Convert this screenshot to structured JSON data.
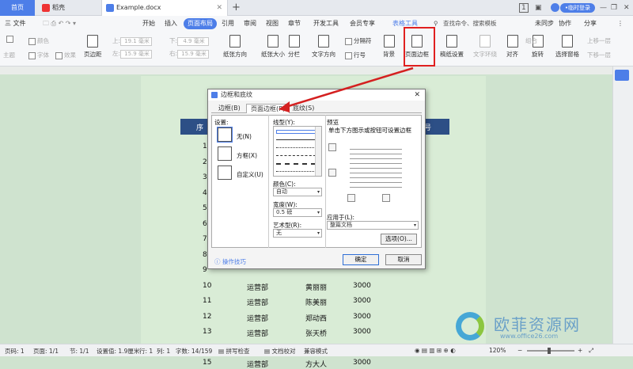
{
  "tabs": {
    "home": "首页",
    "doc": "稻壳",
    "file": "Example.docx"
  },
  "window": {
    "login_label": "•临时登录",
    "badge": "1"
  },
  "menu": {
    "file": "三 文件",
    "items": [
      "开始",
      "插入",
      "页面布局",
      "引用",
      "审阅",
      "视图",
      "章节",
      "开发工具",
      "会员专享",
      "表格工具"
    ],
    "active": "页面布局",
    "search": "查找命令、搜索模板",
    "right": [
      "未同步",
      "协作",
      "分享"
    ]
  },
  "ribbon": {
    "theme": "主题",
    "color": "颜色",
    "font": "字体",
    "effect": "效果",
    "margin": "页边距",
    "top_label": "上:",
    "top_value": "19.1 毫米",
    "bottom_label": "下:",
    "bottom_value": "4.9 毫米",
    "left_label": "左:",
    "left_value": "15.9 毫米",
    "right_label": "右:",
    "right_value": "15.9 毫米",
    "orientation": "纸张方向",
    "size": "纸张大小",
    "columns": "分栏",
    "text_dir": "文字方向",
    "breaks": "分隔符",
    "line_num": "行号",
    "background": "背景",
    "page_border": "页面边框",
    "draft": "稿纸设置",
    "text_wrap": "文字环绕",
    "align": "对齐",
    "rotate": "旋转",
    "select_pane": "选择窗格",
    "group": "组合",
    "up_layer": "上移一层",
    "down_layer": "下移一层"
  },
  "table": {
    "header": [
      "序",
      "号"
    ],
    "rows": [
      {
        "n": "1"
      },
      {
        "n": "2"
      },
      {
        "n": "3"
      },
      {
        "n": "4"
      },
      {
        "n": "5"
      },
      {
        "n": "6"
      },
      {
        "n": "7"
      },
      {
        "n": "8"
      },
      {
        "n": "9"
      },
      {
        "n": "10",
        "dept": "运营部",
        "name": "黄丽丽",
        "amt": "3000"
      },
      {
        "n": "11",
        "dept": "运营部",
        "name": "陈美丽",
        "amt": "3000"
      },
      {
        "n": "12",
        "dept": "运营部",
        "name": "郑动西",
        "amt": "3000"
      },
      {
        "n": "13",
        "dept": "运营部",
        "name": "张天桥",
        "amt": "3000"
      },
      {
        "n": "14",
        "dept": "运营部",
        "name": "李景田",
        "amt": "3000"
      },
      {
        "n": "15",
        "dept": "运营部",
        "name": "方大人",
        "amt": "3000"
      }
    ]
  },
  "dialog": {
    "title": "边框和底纹",
    "tabs": [
      "边框(B)",
      "页面边框(P)",
      "底纹(S)"
    ],
    "setting_label": "设置:",
    "settings": [
      "无(N)",
      "方框(X)",
      "自定义(U)"
    ],
    "line_style": "线型(Y):",
    "color_label": "颜色(C):",
    "color_value": "自动",
    "width_label": "宽度(W):",
    "width_value": "0.5 磅",
    "art_label": "艺术型(R):",
    "art_value": "无",
    "preview_label": "预览",
    "preview_hint": "单击下方图示或按钮可设置边框",
    "apply_label": "应用于(L):",
    "apply_value": "整篇文档",
    "options_btn": "选项(O)...",
    "tips": "操作技巧",
    "ok": "确定",
    "cancel": "取消"
  },
  "status": {
    "page_num": "页码: 1",
    "pages": "页面: 1/1",
    "section": "节: 1/1",
    "setting": "设置值: 1.9厘米",
    "row": "行: 1",
    "col": "列: 1",
    "words": "字数: 14/159",
    "spell": "拼写检查",
    "proof": "文档校对",
    "compat": "兼容模式",
    "zoom": "120%"
  },
  "watermark": {
    "main": "欧菲资源网",
    "sub": "www.office26.com"
  }
}
